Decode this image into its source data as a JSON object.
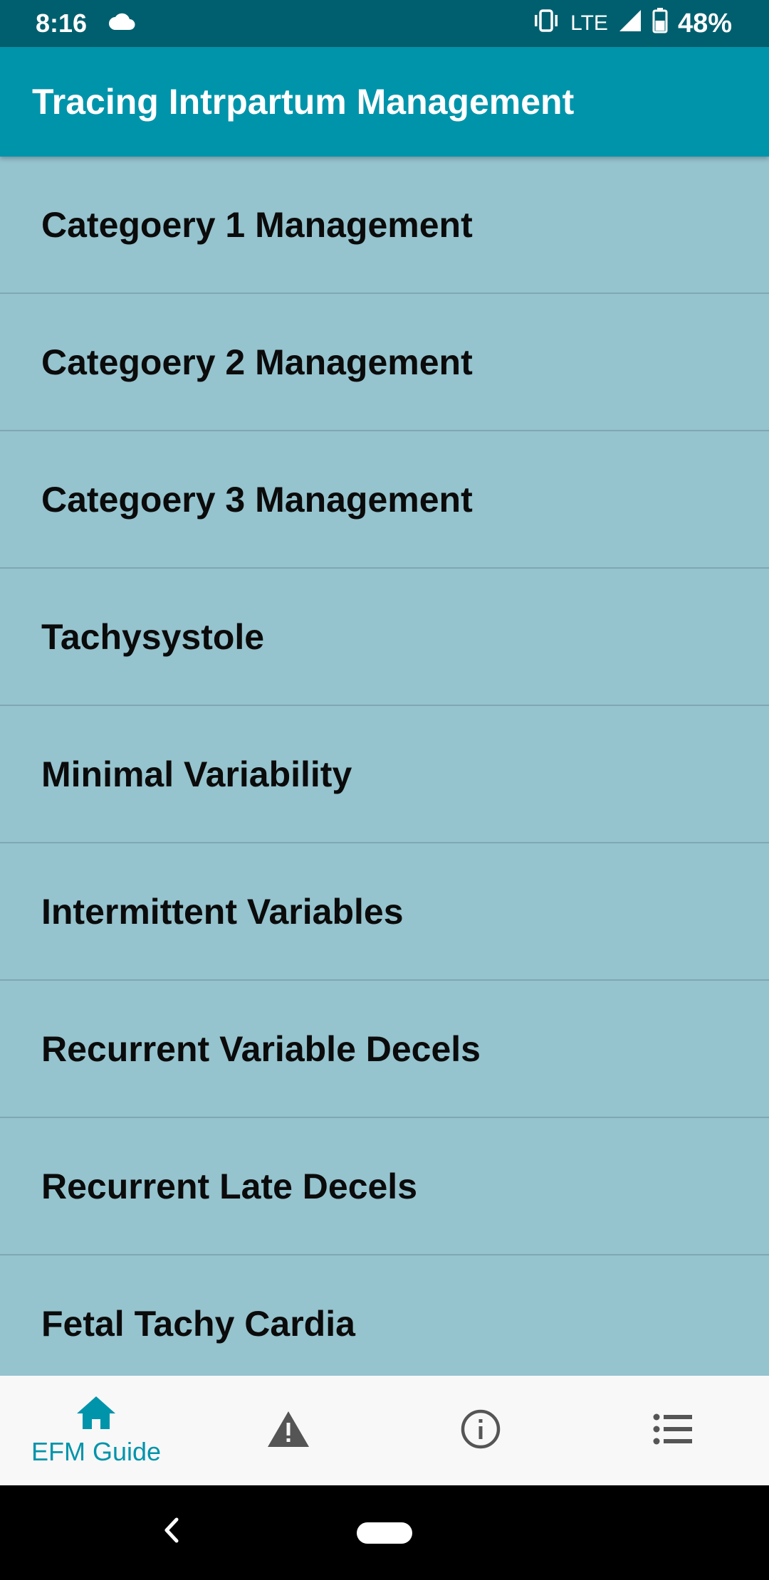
{
  "status_bar": {
    "time": "8:16",
    "network": "LTE",
    "battery": "48%",
    "icons": [
      "cloud-icon",
      "vibrate-icon",
      "signal-icon",
      "battery-icon"
    ]
  },
  "app_bar": {
    "title": "Tracing Intrpartum Management"
  },
  "list": {
    "items": [
      {
        "label": "Categoery 1 Management"
      },
      {
        "label": "Categoery 2 Management"
      },
      {
        "label": "Categoery 3 Management"
      },
      {
        "label": "Tachysystole"
      },
      {
        "label": "Minimal Variability"
      },
      {
        "label": "Intermittent Variables"
      },
      {
        "label": "Recurrent Variable Decels"
      },
      {
        "label": "Recurrent Late Decels"
      },
      {
        "label": "Fetal Tachy Cardia"
      }
    ]
  },
  "bottom_nav": {
    "items": [
      {
        "label": "EFM Guide",
        "icon": "home-icon",
        "active": true
      },
      {
        "label": "",
        "icon": "warning-icon",
        "active": false
      },
      {
        "label": "",
        "icon": "info-icon",
        "active": false
      },
      {
        "label": "",
        "icon": "list-icon",
        "active": false
      }
    ]
  },
  "colors": {
    "status_bar": "#005f6e",
    "app_bar": "#0094aa",
    "list_background": "#95c3ce",
    "active_nav": "#0094aa",
    "inactive_nav": "#555555"
  }
}
